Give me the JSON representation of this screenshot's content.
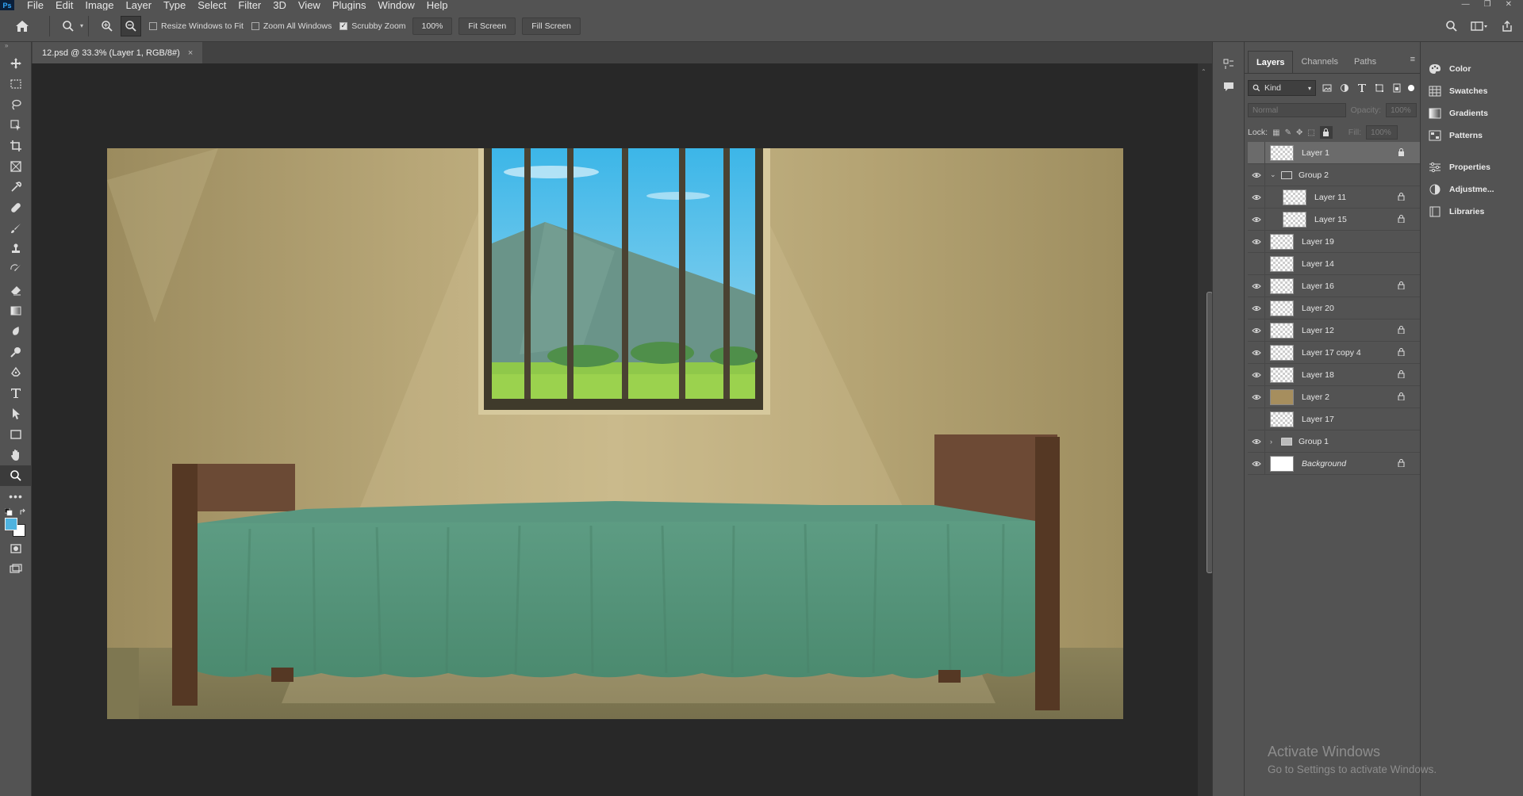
{
  "menu": {
    "app_logo": "Ps",
    "items": [
      "File",
      "Edit",
      "Image",
      "Layer",
      "Type",
      "Select",
      "Filter",
      "3D",
      "View",
      "Plugins",
      "Window",
      "Help"
    ]
  },
  "options": {
    "resize_windows": "Resize Windows to Fit",
    "zoom_all": "Zoom All Windows",
    "scrubby": "Scrubby Zoom",
    "zoom_value": "100%",
    "fit_screen": "Fit Screen",
    "fill_screen": "Fill Screen"
  },
  "document": {
    "tab_title": "12.psd @ 33.3% (Layer 1, RGB/8#)",
    "close": "×"
  },
  "layers_panel": {
    "tabs": [
      "Layers",
      "Channels",
      "Paths"
    ],
    "kind_label": "Kind",
    "blend_mode": "Normal",
    "opacity_label": "Opacity:",
    "opacity_value": "100%",
    "lock_label": "Lock:",
    "fill_label": "Fill:",
    "fill_value": "100%",
    "layers": [
      {
        "name": "Layer 1",
        "visible": false,
        "locked": true,
        "selected": true
      },
      {
        "name": "Group 2",
        "visible": true,
        "group": true,
        "expanded": true
      },
      {
        "name": "Layer 11",
        "visible": true,
        "locked": true,
        "indent": true
      },
      {
        "name": "Layer 15",
        "visible": true,
        "locked": true,
        "indent": true
      },
      {
        "name": "Layer 19",
        "visible": true,
        "locked": false
      },
      {
        "name": "Layer 14",
        "visible": false,
        "locked": false
      },
      {
        "name": "Layer 16",
        "visible": true,
        "locked": true
      },
      {
        "name": "Layer 20",
        "visible": true,
        "locked": false
      },
      {
        "name": "Layer 12",
        "visible": true,
        "locked": true
      },
      {
        "name": "Layer 17 copy 4",
        "visible": true,
        "locked": true
      },
      {
        "name": "Layer 18",
        "visible": true,
        "locked": true
      },
      {
        "name": "Layer 2",
        "visible": true,
        "locked": true
      },
      {
        "name": "Layer 17",
        "visible": false,
        "locked": false
      },
      {
        "name": "Group 1",
        "visible": true,
        "group": true,
        "expanded": false
      },
      {
        "name": "Background",
        "visible": true,
        "locked": true,
        "italic": true
      }
    ]
  },
  "right_panel": {
    "group1": [
      "Color",
      "Swatches",
      "Gradients",
      "Patterns"
    ],
    "group2": [
      "Properties",
      "Adjustme...",
      "Libraries"
    ]
  },
  "watermark": {
    "line1": "Activate Windows",
    "line2": "Go to Settings to activate Windows."
  },
  "colors": {
    "foreground": "#4fb3e0",
    "background": "#ffffff",
    "ui_bg": "#535353"
  }
}
